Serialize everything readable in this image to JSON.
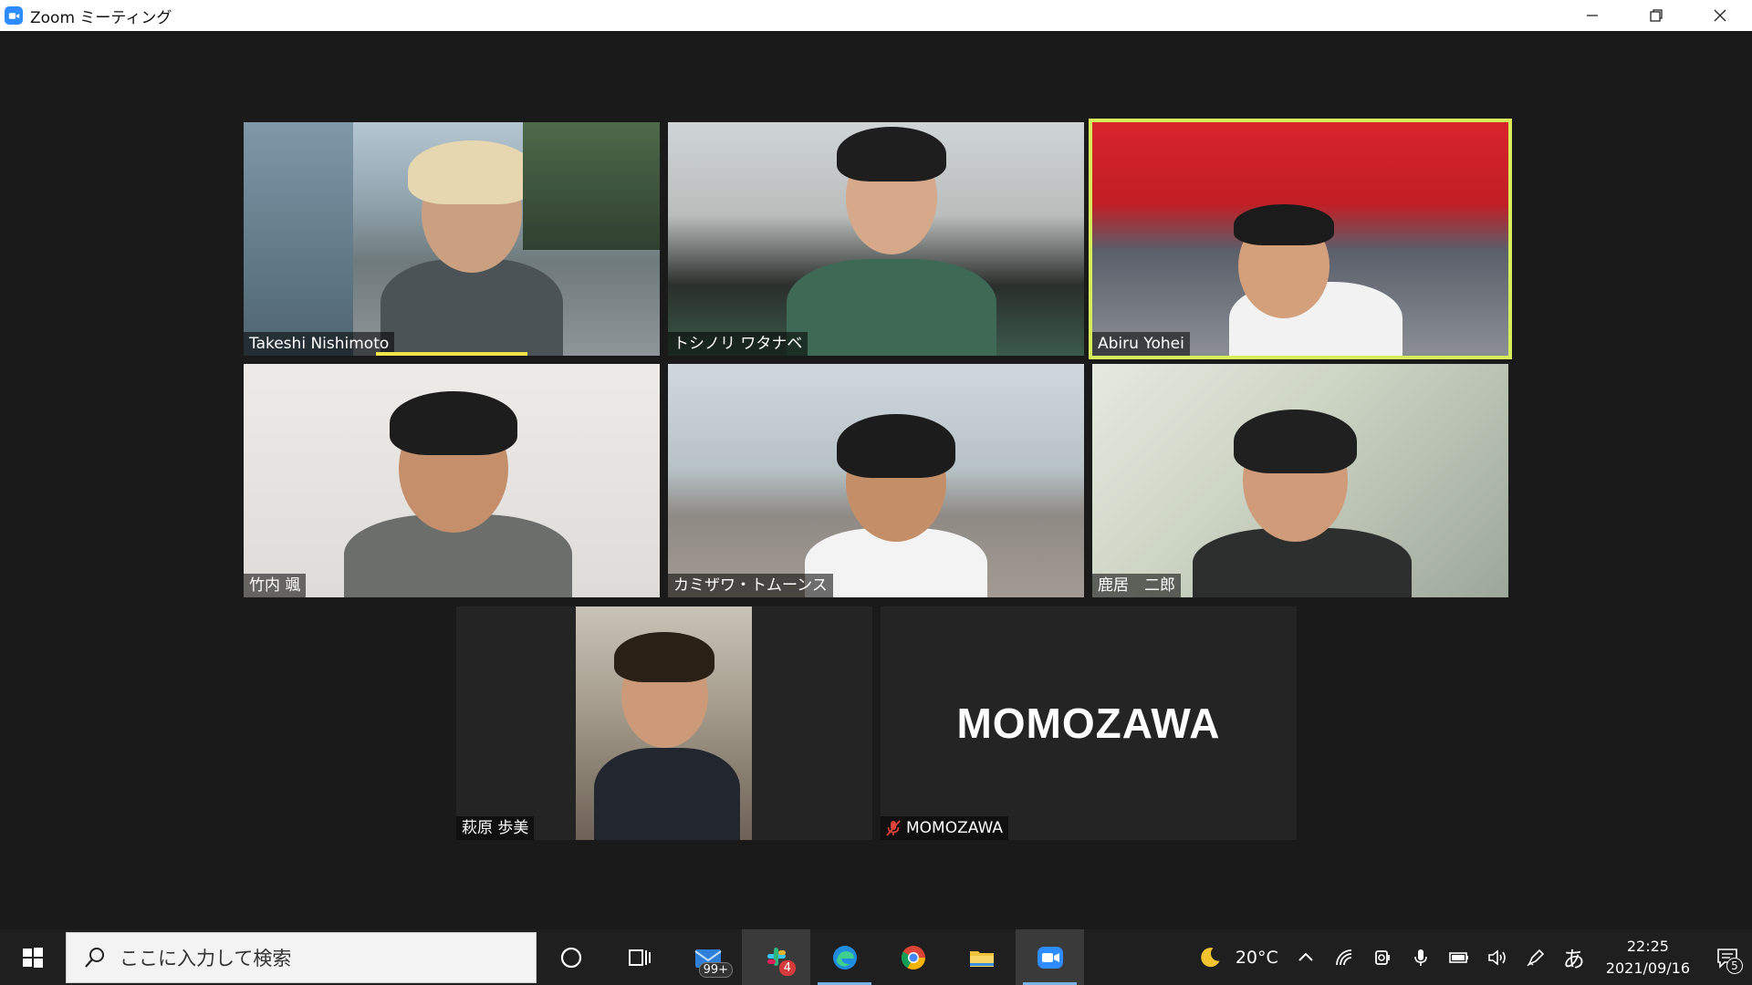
{
  "window": {
    "title": "Zoom ミーティング"
  },
  "participants": [
    {
      "name": "Takeshi Nishimoto",
      "speaking": true
    },
    {
      "name": "トシノリ ワタナベ"
    },
    {
      "name": "Abiru Yohei",
      "active": true
    },
    {
      "name": "竹内 颯"
    },
    {
      "name": "カミザワ・トムーンス"
    },
    {
      "name": "鹿居　二郎"
    },
    {
      "name": "萩原 歩美"
    },
    {
      "name": "MOMOZAWA",
      "video_off": true,
      "muted": true,
      "display_text": "MOMOZAWA"
    }
  ],
  "taskbar": {
    "search_placeholder": "ここに入力して検索",
    "mail_badge": "99+",
    "slack_badge": "4",
    "weather": "20°C",
    "ime": "あ",
    "time": "22:25",
    "date": "2021/09/16",
    "notifications": "5"
  },
  "colors": {
    "active_speaker_border": "#d7ee5a",
    "speaking_indicator": "#f1e54a",
    "zoom_blue": "#2d8cff",
    "muted_red": "#e0433a"
  }
}
